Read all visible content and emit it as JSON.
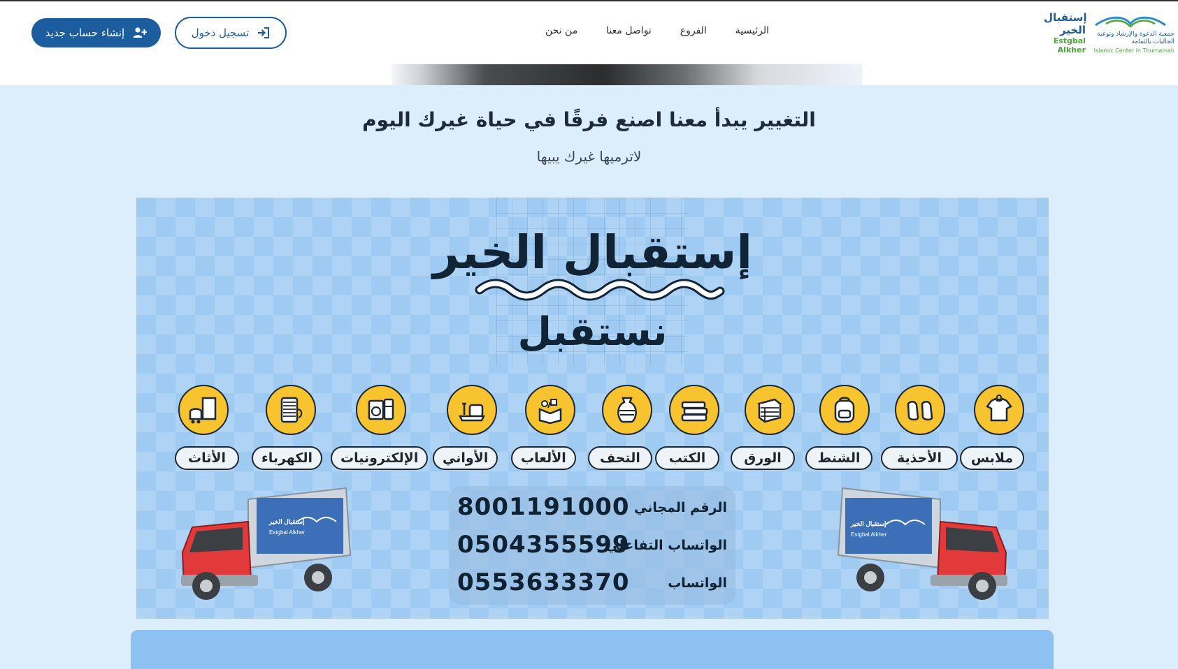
{
  "header": {
    "register_label": "إنشاء حساب جديد",
    "login_label": "تسجيل دخول",
    "nav": [
      "الرئيسية",
      "الفروع",
      "تواصل معنا",
      "من نحن"
    ],
    "logo": {
      "brand_ar": "إستقبال الخير",
      "brand_en": "Estgbal Alkher",
      "org_ar": "جمعية الدعوة والإرشاد وتوعية الجاليات بالثمامة",
      "org_en": "Islamic Center in Thumamah"
    }
  },
  "headline": "التغيير يبدأ معنا اصنع فرقًا في حياة غيرك اليوم",
  "subline": "لاترميها غيرك يبيها",
  "banner": {
    "title": "إستقبال الخير",
    "subtitle": "نستقبل",
    "categories": [
      {
        "label": "ملابس",
        "icon": "shirt-icon"
      },
      {
        "label": "الأحذية",
        "icon": "shoes-icon"
      },
      {
        "label": "الشنط",
        "icon": "backpack-icon"
      },
      {
        "label": "الورق",
        "icon": "paper-stack-icon"
      },
      {
        "label": "الكتب",
        "icon": "books-icon"
      },
      {
        "label": "التحف",
        "icon": "vase-icon"
      },
      {
        "label": "الألعاب",
        "icon": "toy-box-icon"
      },
      {
        "label": "الأواني",
        "icon": "cookware-icon"
      },
      {
        "label": "الإلكترونيات",
        "icon": "appliances-icon"
      },
      {
        "label": "الكهرباء",
        "icon": "cable-spool-icon"
      },
      {
        "label": "الأثاث",
        "icon": "furniture-icon"
      }
    ],
    "contacts": [
      {
        "label": "الرقم المجاني",
        "number": "8001191000"
      },
      {
        "label": "الواتساب التفاعلي",
        "number": "0504355599"
      },
      {
        "label": "الواتساب",
        "number": "0553633370"
      }
    ],
    "truck_sign": {
      "brand_ar": "إستقبال الخير",
      "brand_en": "Estgbal Alkher"
    }
  },
  "colors": {
    "primary": "#1b5d9e",
    "background": "#dcedfc",
    "banner": "#9fcbf3",
    "icon_circle": "#f7c430",
    "truck_red": "#e23a3a"
  }
}
